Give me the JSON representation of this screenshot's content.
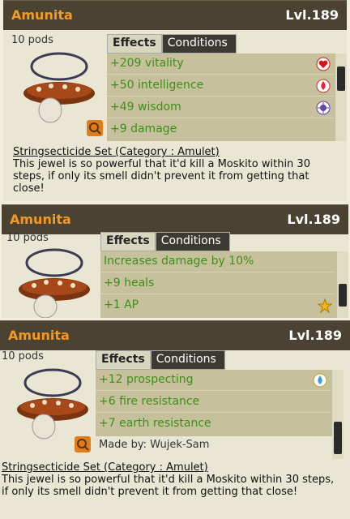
{
  "cards": [
    {
      "title": "Amunita",
      "level": "Lvl.189",
      "pods": "10 pods",
      "tabs": {
        "effects": "Effects",
        "conditions": "Conditions"
      },
      "effects": [
        {
          "text": "+209 vitality",
          "icon": "heart-icon"
        },
        {
          "text": "+50 intelligence",
          "icon": "fire-icon"
        },
        {
          "text": "+49 wisdom",
          "icon": "wisdom-icon"
        },
        {
          "text": "+9 damage",
          "icon": ""
        }
      ],
      "set_line": "Stringsecticide Set (Category : Amulet)",
      "description": "This jewel is so powerful that it'd kill a Moskito within 30 steps, if only its smell didn't prevent it from getting that close!"
    },
    {
      "title": "Amunita",
      "level": "Lvl.189",
      "pods": "10 pods",
      "tabs": {
        "effects": "Effects",
        "conditions": "Conditions"
      },
      "effects": [
        {
          "text": "Increases damage by 10%",
          "icon": ""
        },
        {
          "text": "+9 heals",
          "icon": ""
        },
        {
          "text": "+1 AP",
          "icon": "star-icon"
        }
      ]
    },
    {
      "title": "Amunita",
      "level": "Lvl.189",
      "pods": "10 pods",
      "tabs": {
        "effects": "Effects",
        "conditions": "Conditions"
      },
      "effects": [
        {
          "text": "+12 prospecting",
          "icon": "water-drop-icon"
        },
        {
          "text": "+6 fire resistance",
          "icon": ""
        },
        {
          "text": "+7 earth resistance",
          "icon": ""
        }
      ],
      "made_by": "Made by: Wujek-Sam",
      "set_line": "Stringsecticide Set (Category : Amulet)",
      "description": "This jewel is so powerful that it'd kill a Moskito within 30 steps, if only its smell didn't prevent it from getting that close!"
    }
  ],
  "colors": {
    "title_orange": "#f39a22",
    "effect_green": "#3e8f18",
    "titlebar_brown": "#4b4232",
    "effects_bg": "#c6c19c"
  }
}
